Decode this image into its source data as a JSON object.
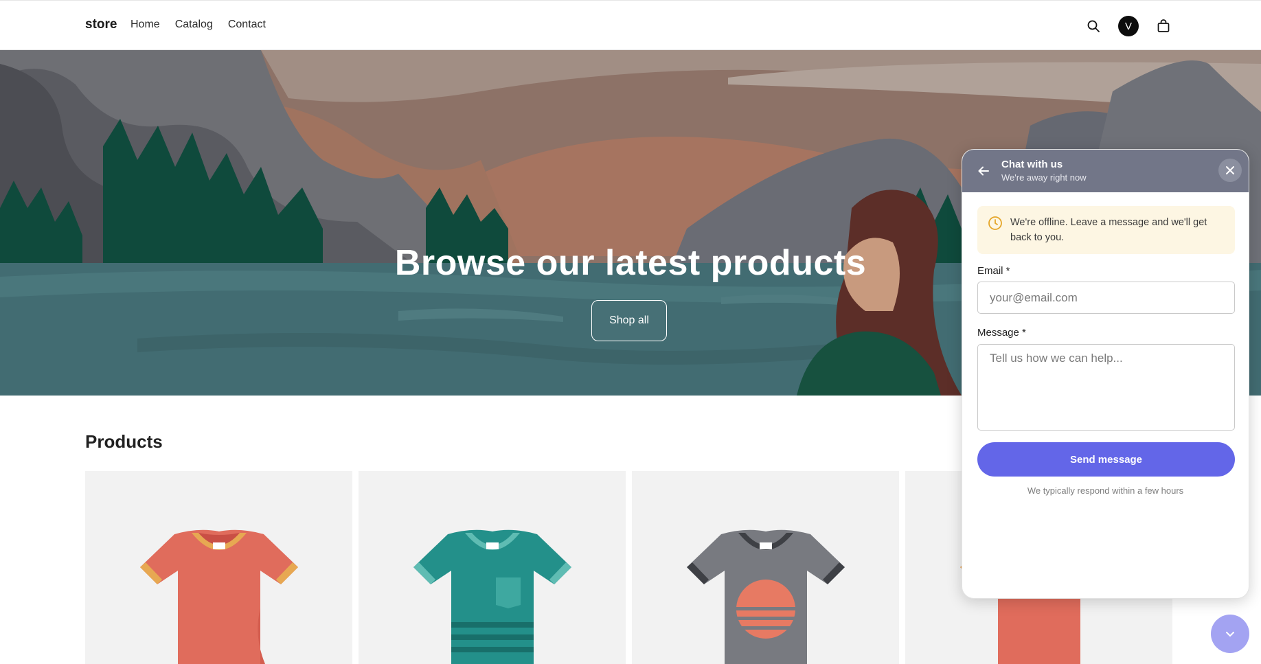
{
  "header": {
    "brand": "store",
    "nav": [
      "Home",
      "Catalog",
      "Contact"
    ],
    "avatar_initial": "V",
    "icons": [
      "search-icon",
      "account-avatar",
      "cart-icon"
    ]
  },
  "hero": {
    "title": "Browse our latest products",
    "button": "Shop all"
  },
  "products": {
    "title": "Products",
    "items": [
      {
        "color": "#e06c5c",
        "trim": "#e7a852",
        "icon": "tshirt-icon"
      },
      {
        "color": "#23908a",
        "trim": "#5fbcb3",
        "icon": "tshirt-icon"
      },
      {
        "color": "#787a80",
        "trim": "#3e4045",
        "icon": "tshirt-icon"
      },
      {
        "color": "#e06c5c",
        "trim": "#e7a852",
        "icon": "tshirt-icon"
      }
    ]
  },
  "chat": {
    "title": "Chat with us",
    "subtitle": "We're away right now",
    "notice": "We're offline. Leave a message and we'll get back to you.",
    "email_label": "Email *",
    "email_placeholder": "your@email.com",
    "message_label": "Message *",
    "message_placeholder": "Tell us how we can help...",
    "send": "Send message",
    "respond_note": "We typically respond within a few hours",
    "accent": "#6366e8",
    "header_color": "#727688"
  }
}
